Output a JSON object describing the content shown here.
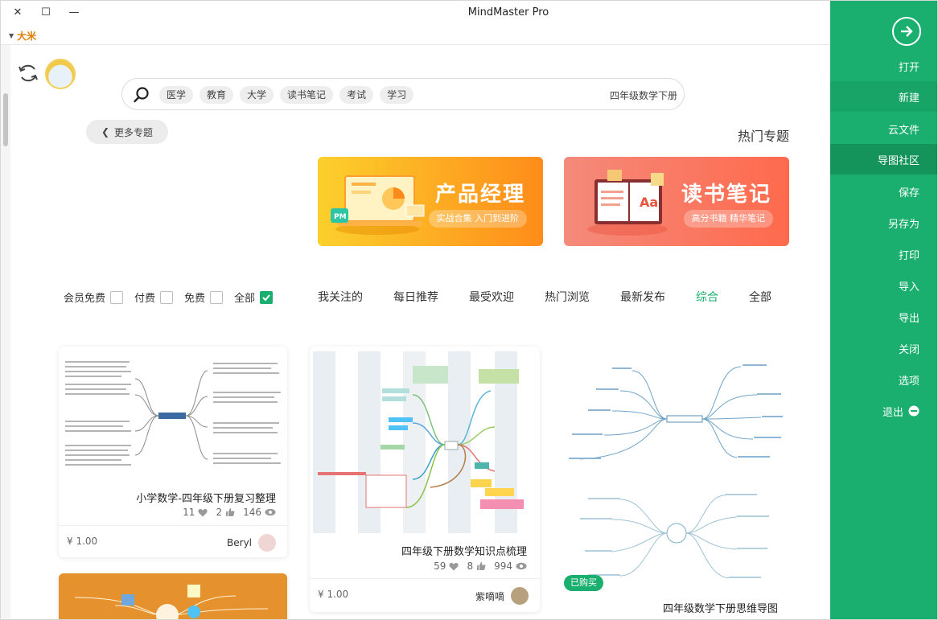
{
  "window": {
    "title": "MindMaster Pro",
    "user": "大米",
    "controls": {
      "close": "✕",
      "maximize": "☐",
      "minimize": "—"
    }
  },
  "search": {
    "value": "四年级数学下册",
    "tags": [
      "学习",
      "考试",
      "读书笔记",
      "大学",
      "教育",
      "医学"
    ]
  },
  "hot": {
    "title": "热门专题",
    "more_label": "更多专题",
    "banners": [
      {
        "title": "读书笔记",
        "subtitle": "高分书籍 精华笔记"
      },
      {
        "title": "产品经理",
        "subtitle": "实战合集 入门到进阶"
      }
    ]
  },
  "filters": {
    "tabs": [
      "全部",
      "综合",
      "最新发布",
      "热门浏览",
      "最受欢迎",
      "每日推荐",
      "我关注的"
    ],
    "active_tab": "综合",
    "checks": [
      {
        "label": "全部",
        "checked": true
      },
      {
        "label": "免费",
        "checked": false
      },
      {
        "label": "付费",
        "checked": false
      },
      {
        "label": "会员免费",
        "checked": false
      }
    ]
  },
  "cards": [
    {
      "title": "小学数学-四年级下册复习整理",
      "views": "146",
      "likes": "2",
      "favs": "11",
      "author": "Beryl",
      "price": "¥ 1.00"
    },
    {
      "title": "四年级下册数学知识点梳理",
      "views": "994",
      "likes": "8",
      "favs": "59",
      "author": "紫嘀嘀",
      "price": "¥ 1.00"
    },
    {
      "title": "四年级数学下册思维导图",
      "badge": "已购买"
    }
  ],
  "sidebar": {
    "items": [
      "打开",
      "新建",
      "云文件",
      "导图社区",
      "保存",
      "另存为",
      "打印",
      "导入",
      "导出",
      "关闭",
      "选项",
      "退出"
    ],
    "selected": "导图社区"
  },
  "colors": {
    "accent": "#1aaf6e",
    "sidebar_bg": "#1aaf6e",
    "user": "#e07b00"
  }
}
